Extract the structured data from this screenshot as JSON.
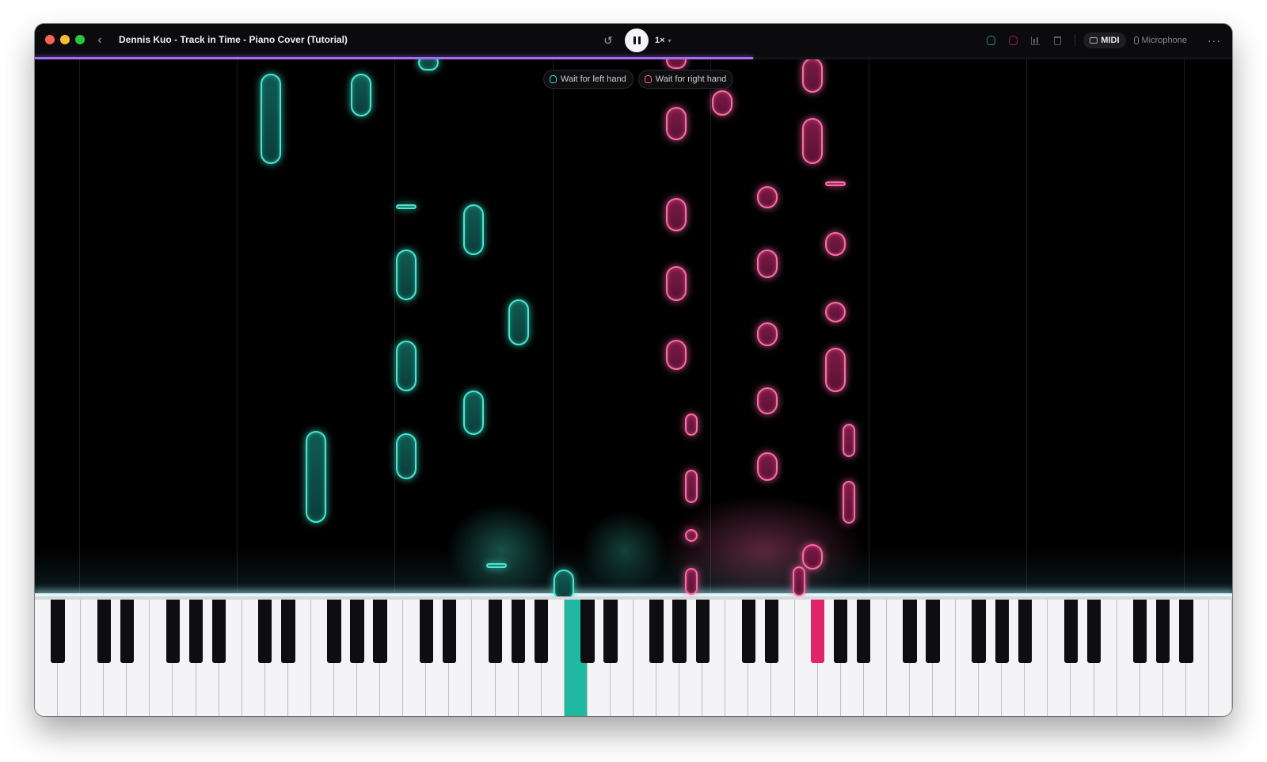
{
  "window": {
    "title": "Dennis Kuo - Track in Time - Piano Cover (Tutorial)"
  },
  "playback": {
    "speed_label": "1×",
    "progress": 0.6
  },
  "toolbar": {
    "midi_label": "MIDI",
    "microphone_label": "Microphone"
  },
  "wait_buttons": {
    "left_label": "Wait for left hand",
    "right_label": "Wait for right hand"
  },
  "colors": {
    "left_hand": "#46e8d0",
    "right_hand": "#ff6ba6",
    "progress": "#a56cf5",
    "close": "#ff5f57",
    "minimize": "#febc2e",
    "maximize": "#28c840"
  },
  "icons": [
    "chevron-left-icon",
    "restart-icon",
    "pause-icon",
    "chevron-down-icon",
    "left-hand-icon",
    "right-hand-icon",
    "stats-icon",
    "trash-icon",
    "midi-icon",
    "microphone-icon",
    "more-icon"
  ],
  "keyboard": {
    "white_key_count": 52,
    "pressed_left_white_key_index": 23,
    "pressed_right_black_key_index": 23
  }
}
